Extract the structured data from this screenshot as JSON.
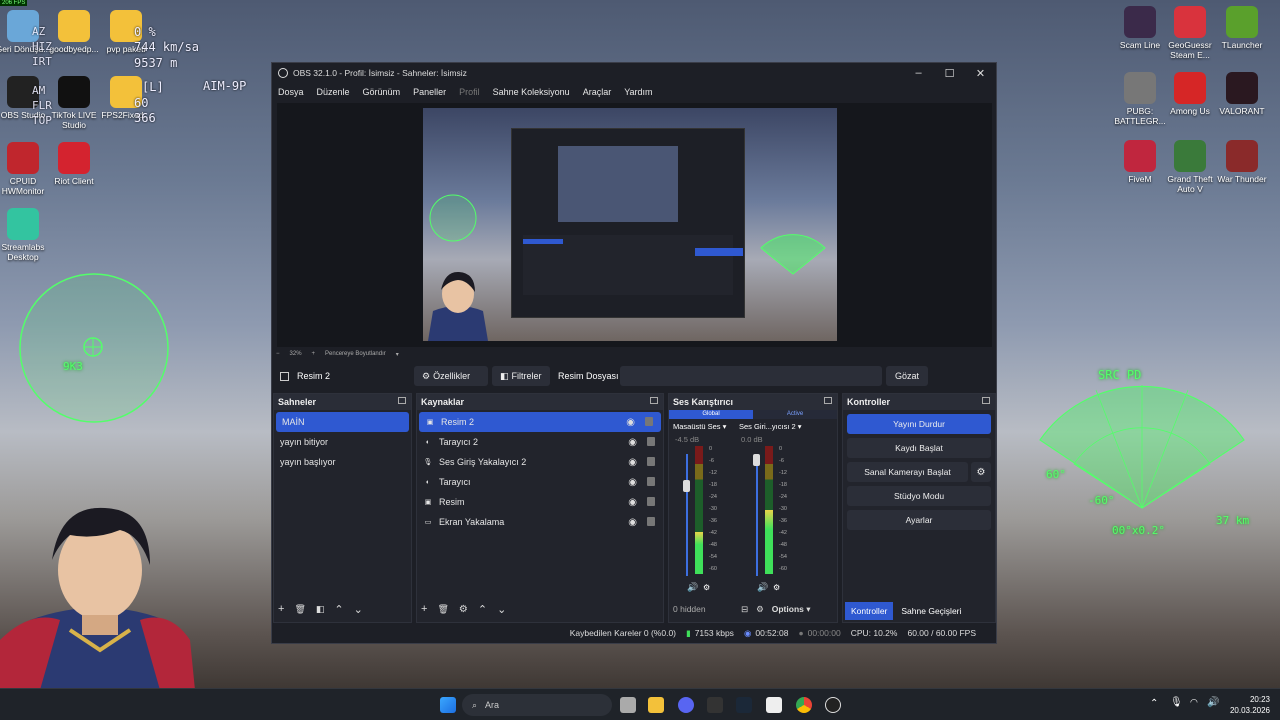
{
  "fps_badge": "206 FPS",
  "desktop_left": [
    {
      "label": "Geri Dönüşü...",
      "icon": "recycle-bin-icon"
    },
    {
      "label": "goodbyedp...",
      "icon": "folder-icon"
    },
    {
      "label": "pvp paketi",
      "icon": "folder-icon"
    },
    {
      "label": "OBS Studio",
      "icon": "obs-icon"
    },
    {
      "label": "TikTok LIVE Studio",
      "icon": "tiktok-icon"
    },
    {
      "label": "FPS2Fixed...",
      "icon": "folder-icon"
    },
    {
      "label": "CPUID HWMonitor",
      "icon": "hwmonitor-icon"
    },
    {
      "label": "Riot Client",
      "icon": "riot-icon"
    },
    {
      "label": "Streamlabs Desktop",
      "icon": "streamlabs-icon"
    }
  ],
  "desktop_right": [
    {
      "label": "Scam Line",
      "icon": "scamline-icon"
    },
    {
      "label": "GeoGuessr Steam E...",
      "icon": "geoguessr-icon"
    },
    {
      "label": "TLauncher",
      "icon": "tlauncher-icon"
    },
    {
      "label": "PUBG: BATTLEGR...",
      "icon": "pubg-icon"
    },
    {
      "label": "Among Us",
      "icon": "amongus-icon"
    },
    {
      "label": "VALORANT",
      "icon": "valorant-icon"
    },
    {
      "label": "FiveM",
      "icon": "fivem-icon"
    },
    {
      "label": "Grand Theft Auto V",
      "icon": "gta-icon"
    },
    {
      "label": "War Thunder",
      "icon": "warthunder-icon"
    }
  ],
  "hud": {
    "left_lines": [
      "AZ",
      "HIZ",
      "IRT",
      "AM",
      "FLR",
      "TOP"
    ],
    "speed": "744 km/sa",
    "throttle": "0 %",
    "altitude": "9537 m",
    "gear": "[L]",
    "rpm": "60",
    "heading": "366",
    "missile": "AIM-9P",
    "crosshair_label": "9K3",
    "radar_title": "SRC PD",
    "radar_left": "60°",
    "radar_left2": "-60°",
    "radar_bottom": "00°x0.2°",
    "radar_right": "37 km"
  },
  "obs": {
    "title": "OBS 32.1.0 - Profil: İsimsiz - Sahneler: İsimsiz",
    "menu": [
      "Dosya",
      "Düzenle",
      "Görünüm",
      "Paneller",
      "Profil",
      "Sahne Koleksiyonu",
      "Araçlar",
      "Yardım"
    ],
    "zoom": "32%",
    "zoom_mode": "Pencereye Boyutlandır",
    "source_bar": {
      "selected": "Resim 2",
      "properties": "Özellikler",
      "filters": "Filtreler",
      "file_label": "Resim Dosyası",
      "browse": "Gözat"
    },
    "scenes": {
      "title": "Sahneler",
      "items": [
        "MAİN",
        "yayın bitiyor",
        "yayın başlıyor"
      ]
    },
    "sources": {
      "title": "Kaynaklar",
      "items": [
        {
          "label": "Resim 2",
          "icon": "image-icon"
        },
        {
          "label": "Tarayıcı 2",
          "icon": "browser-icon"
        },
        {
          "label": "Ses Giriş Yakalayıcı 2",
          "icon": "mic-icon"
        },
        {
          "label": "Tarayıcı",
          "icon": "browser-icon"
        },
        {
          "label": "Resim",
          "icon": "image-icon"
        },
        {
          "label": "Ekran Yakalama",
          "icon": "monitor-icon"
        }
      ]
    },
    "mixer": {
      "title": "Ses Karıştırıcı",
      "tab_global": "Global",
      "tab_active": "Active",
      "ch1_name": "Masaüstü Ses",
      "ch1_db": "-4.5 dB",
      "ch1_level": 0.33,
      "ch2_name": "Ses Giri...yıcısı 2",
      "ch2_db": "0.0 dB",
      "ch2_level": 0.5,
      "ticks": [
        "0",
        "-6",
        "-12",
        "-18",
        "-24",
        "-30",
        "-36",
        "-42",
        "-48",
        "-54",
        "-60"
      ],
      "hidden": "0 hidden",
      "options": "Options"
    },
    "controls": {
      "title": "Kontroller",
      "stop_stream": "Yayını Durdur",
      "start_record": "Kaydı Başlat",
      "virtual_cam": "Sanal Kamerayı Başlat",
      "studio_mode": "Stüdyo Modu",
      "settings": "Ayarlar",
      "tab_controls": "Kontroller",
      "tab_transitions": "Sahne Geçişleri"
    },
    "status": {
      "dropped": "Kaybedilen Kareler 0 (%0.0)",
      "bitrate": "7153 kbps",
      "stream_time": "00:52:08",
      "rec_time": "00:00:00",
      "cpu": "CPU: 10.2%",
      "fps": "60.00 / 60.00 FPS"
    }
  },
  "taskbar": {
    "search": "Ara",
    "time": "20:23",
    "date": "20.03.2026"
  }
}
